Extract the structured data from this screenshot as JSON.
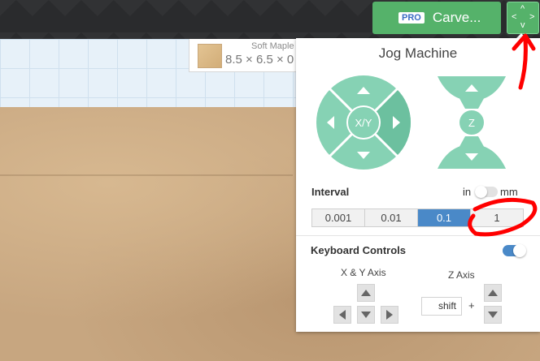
{
  "topbar": {
    "carve_button": {
      "pro_badge": "PRO",
      "label": "Carve..."
    },
    "jog_toggle": {
      "icon": "jog-arrows-icon"
    }
  },
  "material": {
    "name": "Soft Maple",
    "dimensions": "8.5 × 6.5 × 0"
  },
  "jog_panel": {
    "title": "Jog Machine",
    "xy_pad": {
      "center_label": "X/Y"
    },
    "z_pad": {
      "center_label": "Z"
    },
    "interval": {
      "label": "Interval",
      "unit_left": "in",
      "unit_right": "mm",
      "unit_selected": "in",
      "options": [
        "0.001",
        "0.01",
        "0.1",
        "1"
      ],
      "selected": "0.1"
    },
    "keyboard_controls": {
      "label": "Keyboard Controls",
      "enabled": true,
      "xy_axis_label": "X & Y Axis",
      "z_axis_label": "Z Axis",
      "modifier_key": "shift",
      "plus": "+"
    }
  },
  "colors": {
    "accent_green": "#55b26a",
    "selected_blue": "#4a89c8",
    "jog_pad": "#86d2b4",
    "annotation_red": "#ff0000"
  }
}
